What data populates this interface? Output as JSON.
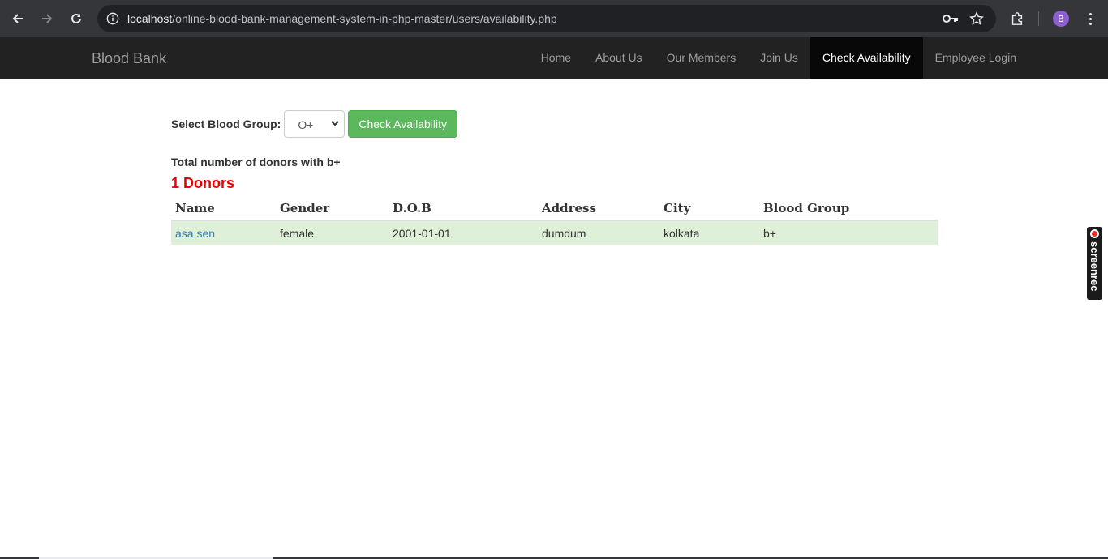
{
  "browser": {
    "url_host": "localhost",
    "url_path": "/online-blood-bank-management-system-in-php-master/users/availability.php",
    "profile_initial": "B"
  },
  "navbar": {
    "brand": "Blood Bank",
    "items": [
      {
        "label": "Home",
        "active": false
      },
      {
        "label": "About Us",
        "active": false
      },
      {
        "label": "Our Members",
        "active": false
      },
      {
        "label": "Join Us",
        "active": false
      },
      {
        "label": "Check Availability",
        "active": true
      },
      {
        "label": "Employee Login",
        "active": false
      }
    ]
  },
  "form": {
    "label": "Select Blood Group:",
    "selected_group": "O+",
    "button_label": "Check Availability"
  },
  "results": {
    "total_text": "Total number of donors with b+",
    "donor_count_text": "1 Donors",
    "columns": [
      "Name",
      "Gender",
      "D.O.B",
      "Address",
      "City",
      "Blood Group"
    ],
    "rows": [
      {
        "name": "asa sen",
        "gender": "female",
        "dob": "2001-01-01",
        "address": "dumdum",
        "city": "kolkata",
        "blood_group": "b+"
      }
    ]
  },
  "widget": {
    "label": "screenrec"
  },
  "colors": {
    "navbar_bg": "#222222",
    "active_nav_bg": "#080808",
    "button_green": "#5cb85c",
    "donor_count_red": "#ee0000",
    "row_bg": "#dff0d8",
    "link_blue": "#337ab7"
  }
}
